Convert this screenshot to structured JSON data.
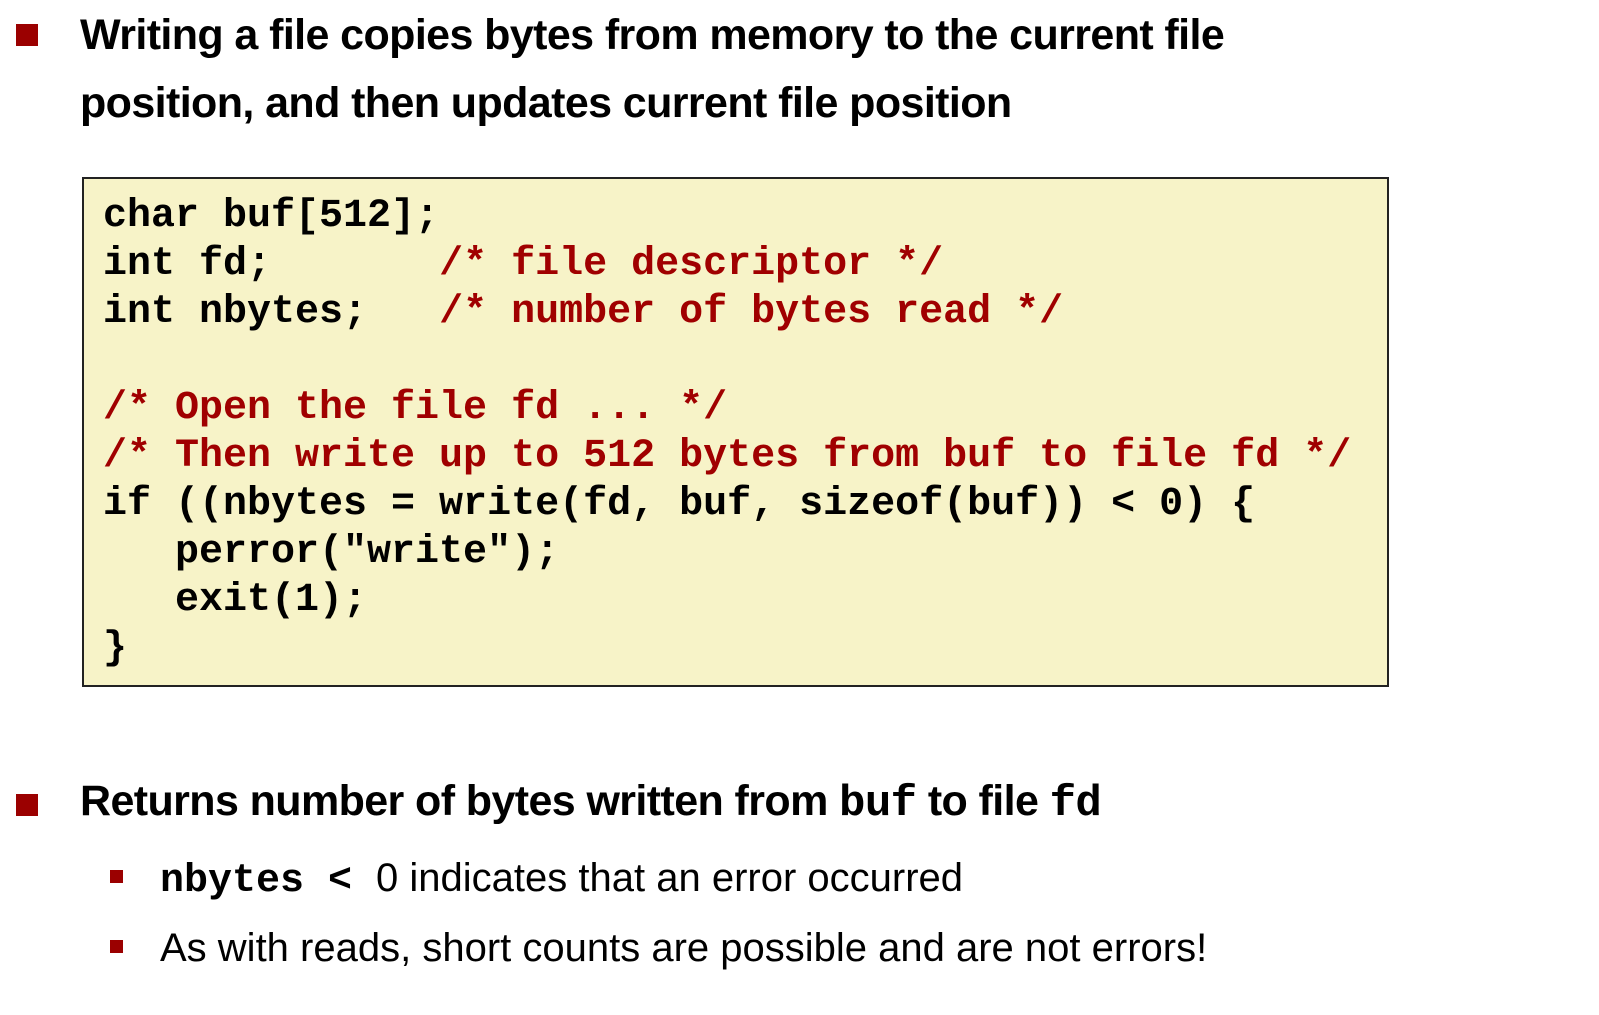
{
  "bullet1": {
    "line1": "Writing a file copies bytes from memory to the current file",
    "line2": "position, and then updates current file position"
  },
  "code": {
    "lines": [
      {
        "code": "char buf[512];",
        "comment": ""
      },
      {
        "code": "int fd;       ",
        "comment": "/* file descriptor */"
      },
      {
        "code": "int nbytes;   ",
        "comment": "/* number of bytes read */"
      },
      {
        "code": "",
        "comment": ""
      },
      {
        "code": "",
        "comment": "/* Open the file fd ... */"
      },
      {
        "code": "",
        "comment": "/* Then write up to 512 bytes from buf to file fd */"
      },
      {
        "code": "if ((nbytes = write(fd, buf, sizeof(buf)) < 0) {",
        "comment": ""
      },
      {
        "code": "   perror(\"write\");",
        "comment": ""
      },
      {
        "code": "   exit(1);",
        "comment": ""
      },
      {
        "code": "}",
        "comment": ""
      }
    ]
  },
  "bullet2": {
    "prefix": "Returns number of bytes written from ",
    "code1": "buf",
    "middle": " to file ",
    "code2": "fd"
  },
  "sub1": {
    "code": "nbytes < ",
    "zero": "0",
    "text": " indicates that an error occurred"
  },
  "sub2": {
    "text": "As with reads, short counts are possible and are not errors!"
  },
  "colors": {
    "accent": "#9b0000",
    "code_bg": "#f7f3c8",
    "comment": "#a00000"
  }
}
